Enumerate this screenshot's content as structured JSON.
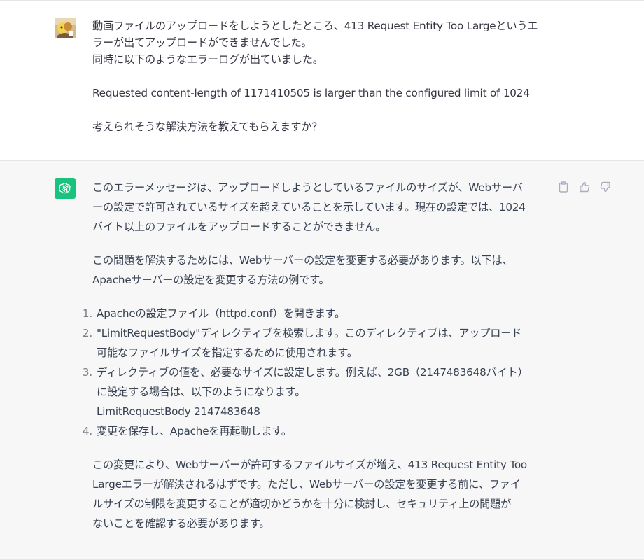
{
  "user_message": {
    "lines": [
      "動画ファイルのアップロードをしようとしたところ、413 Request Entity Too Largeというエ",
      "ラーが出てアップロードができませんでした。",
      "同時に以下のようなエラーログが出ていました。",
      "Requested content-length of 1171410505 is larger than the configured limit of 1024",
      "考えられそうな解決方法を教えてもらえますか？"
    ]
  },
  "assistant_message": {
    "paragraph1": [
      "このエラーメッセージは、アップロードしようとしているファイルのサイズが、Webサーバ",
      "ーの設定で許可されているサイズを超えていることを示しています。現在の設定では、1024",
      "バイト以上のファイルをアップロードすることができません。"
    ],
    "paragraph2": [
      "この問題を解決するためには、Webサーバーの設定を変更する必要があります。以下は、",
      "Apacheサーバーの設定を変更する方法の例です。"
    ],
    "steps": [
      {
        "num": "1.",
        "lines": [
          "Apacheの設定ファイル（httpd.conf）を開きます。"
        ]
      },
      {
        "num": "2.",
        "lines": [
          "\"LimitRequestBody\"ディレクティブを検索します。このディレクティブは、アップロード",
          "可能なファイルサイズを指定するために使用されます。"
        ]
      },
      {
        "num": "3.",
        "lines": [
          "ディレクティブの値を、必要なサイズに設定します。例えば、2GB（2147483648バイト）",
          "に設定する場合は、以下のようになります。",
          "LimitRequestBody 2147483648"
        ]
      },
      {
        "num": "4.",
        "lines": [
          "変更を保存し、Apacheを再起動します。"
        ]
      }
    ],
    "paragraph3": [
      "この変更により、Webサーバーが許可するファイルサイズが増え、413 Request Entity Too",
      "Largeエラーが解決されるはずです。ただし、Webサーバーの設定を変更する前に、ファイ",
      "ルサイズの制限を変更することが適切かどうかを十分に検討し、セキュリティ上の問題が",
      "ないことを確認する必要があります。"
    ]
  },
  "icons": {
    "user_avatar": "user-avatar-image",
    "assistant_avatar": "openai-logo-icon",
    "copy": "clipboard-icon",
    "thumbs_up": "thumbs-up-icon",
    "thumbs_down": "thumbs-down-icon"
  },
  "colors": {
    "assistant_bg": "#f7f7f8",
    "avatar_green": "#19c37d",
    "text": "#343541"
  }
}
